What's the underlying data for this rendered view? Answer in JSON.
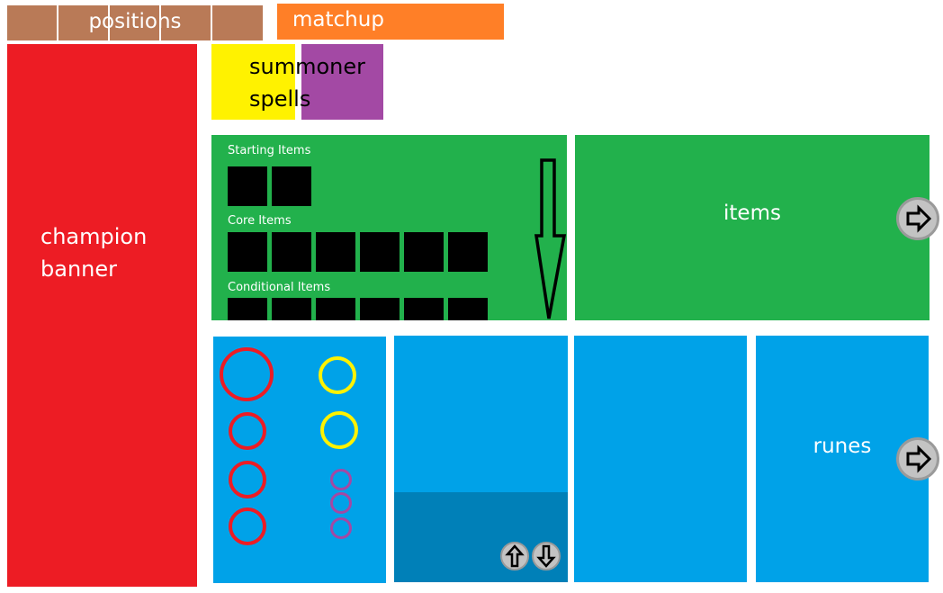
{
  "top_bar": {
    "positions_label": "positions",
    "matchup_label": "matchup"
  },
  "champion": {
    "label_line1": "champion",
    "label_line2": "banner"
  },
  "summoner": {
    "label_line1": "summoner",
    "label_line2": "spells"
  },
  "build": {
    "starting_label": "Starting Items",
    "core_label": "Core Items",
    "conditional_label": "Conditional Items"
  },
  "items": {
    "label": "items"
  },
  "runes": {
    "label": "runes"
  },
  "colors": {
    "positions": "#b97a57",
    "matchup": "#ff7f27",
    "champion": "#ed1c24",
    "spell_1": "#fff200",
    "spell_2": "#a349a4",
    "items": "#22b14c",
    "runes": "#00a2e8",
    "runes_dark": "#0080b8"
  },
  "icons": {
    "scroll_arrow": "down-arrow-icon",
    "items_next": "right-arrow-icon",
    "runes_next": "right-arrow-icon",
    "scroll_up": "up-arrow-icon",
    "scroll_down": "down-arrow-icon"
  }
}
